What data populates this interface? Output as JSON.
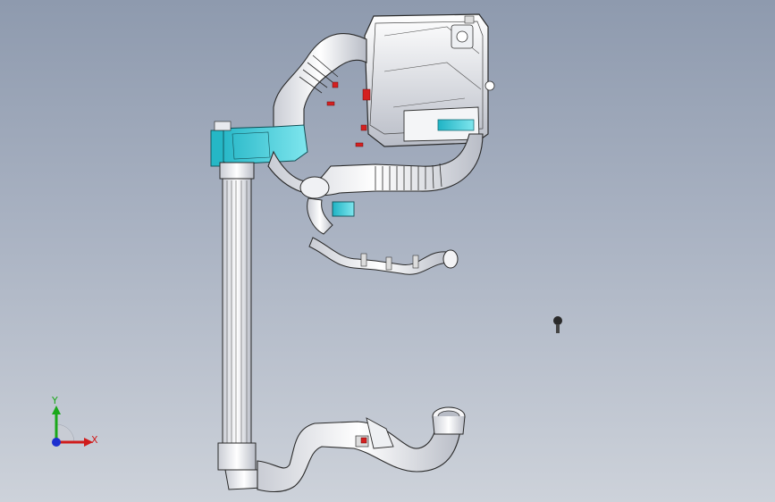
{
  "scene": {
    "background_top": "#8e9aae",
    "background_bottom": "#cdd2da",
    "accent_cyan": "#35c9d6",
    "hardware_red": "#d42020"
  },
  "triad": {
    "y_label": "Y",
    "x_label": "X",
    "y_color": "#1aa81a",
    "x_color": "#d01c1c",
    "z_color": "#1c2fd0"
  },
  "parts": [
    {
      "name": "air-filter-box"
    },
    {
      "name": "upper-bent-duct"
    },
    {
      "name": "corrugated-bellows"
    },
    {
      "name": "cyan-inlet-flange"
    },
    {
      "name": "charge-air-cooler"
    },
    {
      "name": "resonator-hose-assembly"
    },
    {
      "name": "breather-pipe"
    },
    {
      "name": "lower-outlet-duct"
    },
    {
      "name": "loose-bolt"
    }
  ]
}
